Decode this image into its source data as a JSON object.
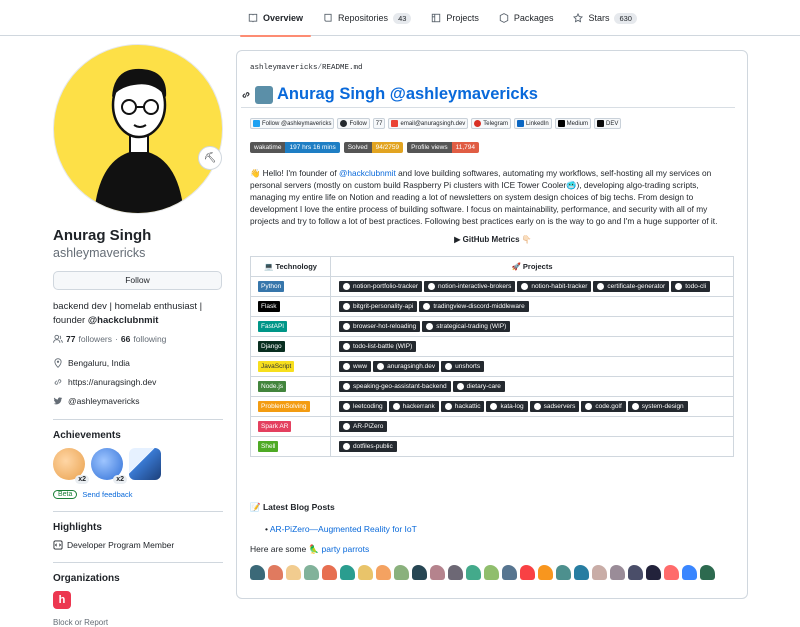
{
  "tabs": [
    {
      "label": "Overview",
      "count": ""
    },
    {
      "label": "Repositories",
      "count": "43"
    },
    {
      "label": "Projects",
      "count": ""
    },
    {
      "label": "Packages",
      "count": ""
    },
    {
      "label": "Stars",
      "count": "630"
    }
  ],
  "profile": {
    "name": "Anurag Singh",
    "login": "ashleymavericks",
    "follow_label": "Follow",
    "bio_text": "backend dev | homelab enthusiast | founder ",
    "bio_org": "@hackclubnmit",
    "followers": "77",
    "followers_label": "followers",
    "following": "66",
    "following_label": "following",
    "location": "Bengaluru, India",
    "website": "https://anuragsingh.dev",
    "twitter": "@ashleymavericks"
  },
  "achievements": {
    "title": "Achievements",
    "items": [
      {
        "name": "pull-shark-badge",
        "count": "x2"
      },
      {
        "name": "starstruck-badge",
        "count": "x2"
      },
      {
        "name": "arctic-code-vault-badge",
        "count": ""
      }
    ],
    "beta": "Beta",
    "feedback": "Send feedback"
  },
  "highlights": {
    "title": "Highlights",
    "item": "Developer Program Member"
  },
  "organizations": {
    "title": "Organizations",
    "block": "Block or Report"
  },
  "readme": {
    "path_user": "ashleymavericks",
    "path_sep": "/",
    "path_file": "README.md",
    "heading": "Anurag Singh @ashleymavericks",
    "social": [
      {
        "label": "Follow @ashleymavericks",
        "dark": false
      },
      {
        "label": "Follow",
        "dark": false
      },
      {
        "label": "77",
        "dark": false
      },
      {
        "label": "email@anuragsingh.dev",
        "dark": false
      },
      {
        "label": "Telegram",
        "dark": false
      },
      {
        "label": "LinkedIn",
        "dark": false
      },
      {
        "label": "Medium",
        "dark": false
      },
      {
        "label": "DEV",
        "dark": false
      }
    ],
    "stats": [
      {
        "label": "wakatime",
        "value": "197 hrs 16 mins",
        "color": "#1e7ec4"
      },
      {
        "label": "Solved",
        "value": "94/2759",
        "color": "#e2a421"
      },
      {
        "label": "Profile views",
        "value": "11,794",
        "color": "#e05d44"
      }
    ],
    "intro_hello": "Hello! I'm founder of ",
    "intro_link": "@hackclubnmit",
    "intro_rest": " and love building softwares, automating my workflows, self-hosting all my services on personal servers (mostly on custom build Raspberry Pi clusters with ICE Tower Cooler🥶), developing algo-trading scripts, managing my entire life on Notion and reading a lot of newsletters on system design choices of big techs. From design to development I love the entire process of building software. I focus on maintainability, performance, and security with all of my projects and try to follow a lot of best practices. Following best practices early on is the way to go and I'm a huge supporter of it.",
    "metrics": "▶ GitHub Metrics 👇🏻",
    "table_head_tech": "💻 Technology",
    "table_head_proj": "🚀 Projects",
    "rows": [
      {
        "tech": "Python",
        "color": "#3776ab",
        "projects": [
          "notion-portfolio-tracker",
          "notion-interactive-brokers",
          "notion-habit-tracker",
          "certificate-generator",
          "todo-cli"
        ]
      },
      {
        "tech": "Flask",
        "color": "#000000",
        "projects": [
          "bitgrit-personality-api",
          "tradingview-discord-middleware"
        ]
      },
      {
        "tech": "FastAPI",
        "color": "#009688",
        "projects": [
          "browser-hot-reloading",
          "strategical-trading (WIP)"
        ]
      },
      {
        "tech": "Django",
        "color": "#092e20",
        "projects": [
          "todo-list-battle (WIP)"
        ]
      },
      {
        "tech": "JavaScript",
        "color": "#f7df1e",
        "projects": [
          "www",
          "anuragsingh.dev",
          "unshorts"
        ]
      },
      {
        "tech": "Node.js",
        "color": "#43853d",
        "projects": [
          "speaking-geo-assistant-backend",
          "dietary-care"
        ]
      },
      {
        "tech": "ProblemSolving",
        "color": "#f39c12",
        "projects": [
          "leetcoding",
          "hackerrank",
          "hackattic",
          "kata-log",
          "sadservers",
          "code.golf",
          "system-design"
        ]
      },
      {
        "tech": "Spark AR",
        "color": "#e4405f",
        "projects": [
          "AR-PiZero"
        ]
      },
      {
        "tech": "Shell",
        "color": "#4eaa25",
        "projects": [
          "dotfiles-public"
        ]
      }
    ],
    "blog_heading": "📝 Latest Blog Posts",
    "blog_post": "AR-PiZero—Augmented Reality for IoT",
    "parrots_text": "Here are some 🦜 ",
    "parrots_link": "party parrots",
    "parrot_colors": [
      "#3b6978",
      "#e07a5f",
      "#f2cc8f",
      "#81b29a",
      "#e76f51",
      "#2a9d8f",
      "#e9c46a",
      "#f4a261",
      "#8ab17d",
      "#264653",
      "#b5838d",
      "#6d6875",
      "#43aa8b",
      "#90be6d",
      "#577590",
      "#f94144",
      "#f8961e",
      "#4d908e",
      "#277da1",
      "#c9ada7",
      "#9a8c98",
      "#4a4e69",
      "#22223b",
      "#ff6b6b",
      "#3a86ff",
      "#2d6a4f"
    ]
  }
}
